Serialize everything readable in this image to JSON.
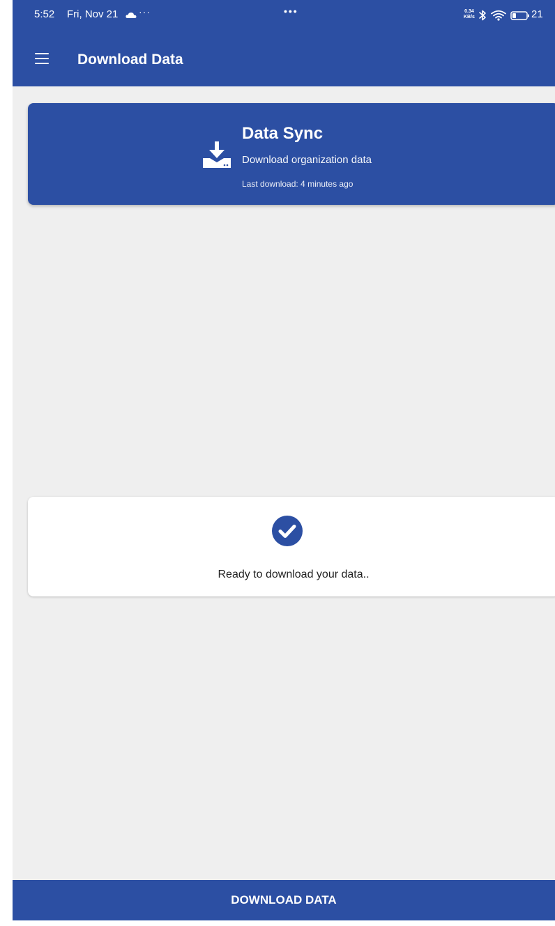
{
  "status_bar": {
    "time": "5:52",
    "date": "Fri, Nov 21",
    "left_more": "···",
    "center_dots": "•••",
    "net_speed_value": "0.34",
    "net_speed_unit": "KB/s",
    "battery": "21"
  },
  "app_bar": {
    "title": "Download Data",
    "menu_icon": "hamburger-menu-icon"
  },
  "sync_card": {
    "icon": "download-tray-icon",
    "title": "Data Sync",
    "subtitle": "Download organization data",
    "last_download": "Last download: 4 minutes ago"
  },
  "status_card": {
    "icon": "check-circle-icon",
    "message": "Ready to download your data.."
  },
  "actions": {
    "download_label": "DOWNLOAD DATA"
  },
  "colors": {
    "primary": "#2c4fa3",
    "background": "#efefef",
    "card": "#ffffff"
  }
}
